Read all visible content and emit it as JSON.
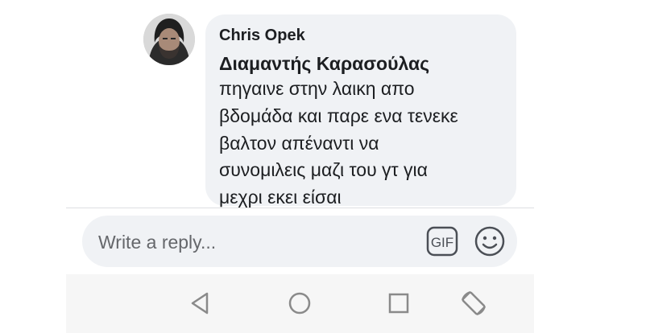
{
  "comment": {
    "author": "Chris Opek",
    "mention": "Διαμαντής Καρασούλας",
    "lines": [
      "πηγαινε στην λαικη απο",
      "βδομάδα και παρε ενα τενεκε",
      "βαλτον απέναντι να",
      "συνομιλεις μαζι του γτ για",
      "μεχρι εκει είσαι"
    ]
  },
  "reply": {
    "placeholder": "Write a reply...",
    "gif_label": "GIF",
    "gif_icon": "gif-icon",
    "emoji_icon": "emoji-icon"
  },
  "navbar": {
    "icons": [
      "back-icon",
      "home-icon",
      "recents-icon",
      "rotate-icon"
    ]
  },
  "colors": {
    "bubble": "#f0f2f5",
    "text": "#1c1e21",
    "placeholder": "#65676b",
    "nav_icon": "#8a8a8a"
  }
}
